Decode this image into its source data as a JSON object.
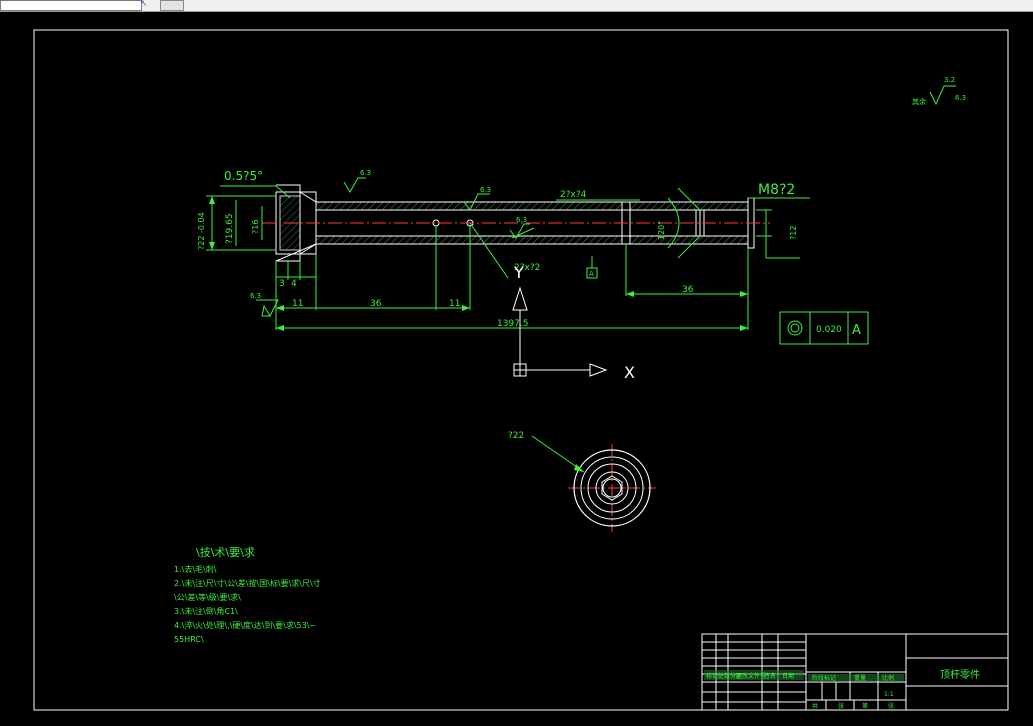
{
  "toolbar": {
    "icon": "cursor-arrow-icon"
  },
  "part_view": {
    "chamfer_note": "0.5?5°",
    "thread_note": "M8?2",
    "slot_note": "2?x?4",
    "hole_note": "2?x?2",
    "roughness_marks": [
      "6.3",
      "6.3",
      "3.2",
      "6.3",
      "6.3"
    ],
    "dim_d22": "?22 -0.04",
    "dim_d19": "?19.65",
    "dim_d16": "?16",
    "dim_d12": "?12",
    "dim_3": "3",
    "dim_4": "4",
    "dim_11a": "11",
    "dim_36a": "36",
    "dim_11b": "11",
    "dim_36b": "36",
    "dim_total": "1397.5",
    "angle": "120°",
    "datum_label": "A",
    "tolerance_value": "0.020",
    "tolerance_datum": "A",
    "corner_note": "其余",
    "corner_value": "6.3"
  },
  "axes": {
    "x_label": "X",
    "y_label": "Y"
  },
  "end_view": {
    "diameter_label": "?22"
  },
  "tech_requirements": {
    "title": "\\技\\术\\要\\求",
    "lines": [
      "1.\\去\\毛\\刺\\",
      "2.\\未\\注\\尺\\寸\\公\\差\\按\\国\\标\\要\\求\\尺\\寸",
      "\\公\\差\\等\\级\\要\\求\\",
      "3.\\未\\注\\倒\\角C1\\",
      "4.\\淬\\火\\处\\理\\,\\硬\\度\\达\\到\\要\\求\\53\\~",
      "55HRC\\"
    ]
  },
  "title_block": {
    "part_name": "顶杆零件",
    "row_labels": [
      "标记",
      "处数",
      "分区",
      "更改文件号",
      "签名",
      "日期"
    ],
    "stage_labels": [
      "阶段标记",
      "重量",
      "比例"
    ],
    "scale": "1:1",
    "bottom_labels": [
      "共",
      "张",
      "第",
      "张"
    ]
  }
}
